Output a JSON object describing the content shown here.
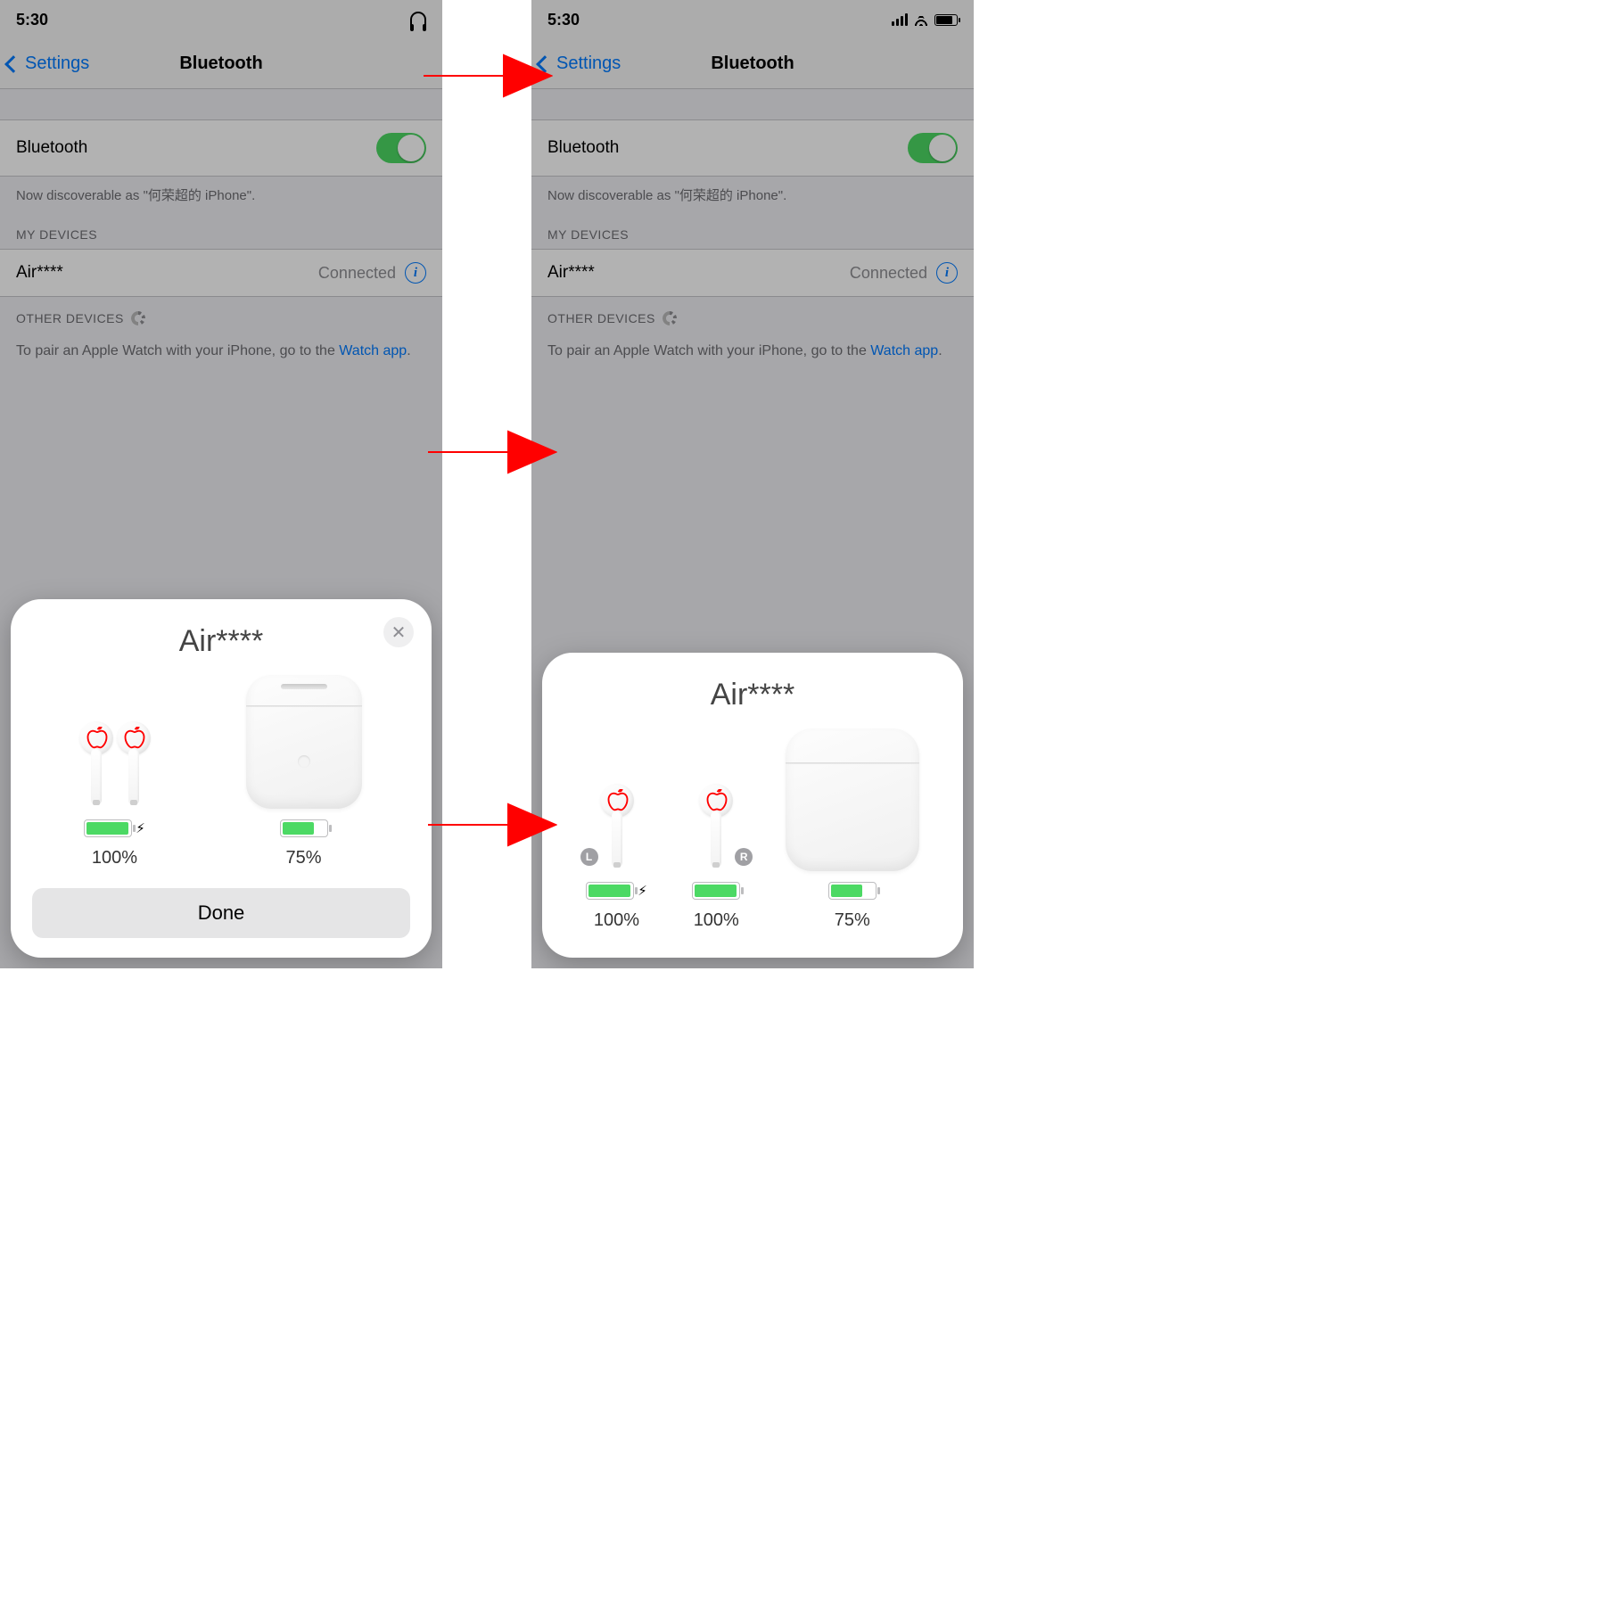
{
  "status": {
    "time": "5:30"
  },
  "nav": {
    "back": "Settings",
    "title": "Bluetooth"
  },
  "bt": {
    "row_label": "Bluetooth"
  },
  "discoverable": "Now discoverable as \"何荣超的 iPhone\".",
  "sections": {
    "my_devices": "MY DEVICES",
    "other_devices": "OTHER DEVICES"
  },
  "device": {
    "name": "Air****",
    "status": "Connected"
  },
  "hint": {
    "prefix": "To pair an Apple Watch with your iPhone, go to the ",
    "link": "Watch app",
    "suffix": "."
  },
  "card1": {
    "title": "Air****",
    "earbuds_pct": "100%",
    "case_pct": "75%",
    "done": "Done"
  },
  "card2": {
    "title": "Air****",
    "left_label": "L",
    "right_label": "R",
    "left_pct": "100%",
    "right_pct": "100%",
    "case_pct": "75%"
  }
}
